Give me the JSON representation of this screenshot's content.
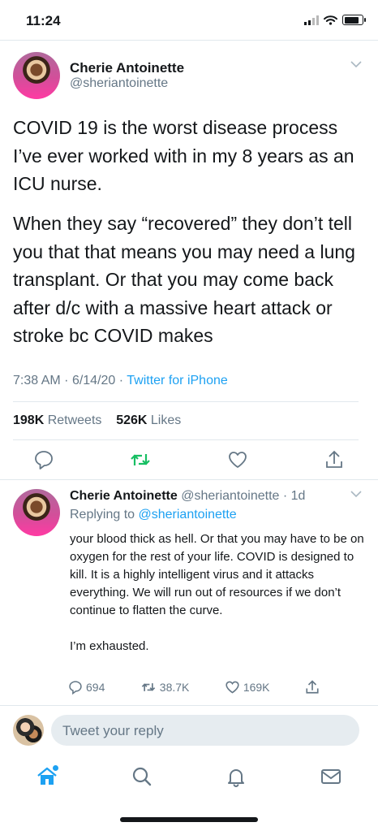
{
  "status_bar": {
    "time": "11:24"
  },
  "main_tweet": {
    "name": "Cherie Antoinette",
    "handle": "@sheriantoinette",
    "paragraphs": [
      "COVID 19 is the worst disease process I’ve ever worked with in my 8 years as an ICU nurse.",
      "When they say “recovered” they don’t tell you that that means you may need a lung transplant. Or that you may come back after d/c with a massive heart attack or stroke bc COVID makes"
    ],
    "time": "7:38 AM",
    "date": "6/14/20",
    "source": "Twitter for iPhone",
    "retweets": "198K",
    "retweets_label": "Retweets",
    "likes": "526K",
    "likes_label": "Likes"
  },
  "reply": {
    "name": "Cherie Antoinette",
    "handle": "@sheriantoinette",
    "age": "1d",
    "replying_label": "Replying to",
    "replying_to": "@sheriantoinette",
    "paragraphs": [
      "your blood thick as hell. Or that you may have to be on oxygen for the rest of your life. COVID is designed to kill. It is a highly intelligent virus and it attacks everything. We will run out of resources if we don’t continue to flatten the curve.",
      "I’m exhausted."
    ],
    "replies": "694",
    "retweets": "38.7K",
    "likes": "169K"
  },
  "composer": {
    "placeholder": "Tweet your reply"
  },
  "colors": {
    "accent": "#1da1f2",
    "retweet": "#17bf63",
    "muted": "#657786",
    "text": "#14171a"
  }
}
